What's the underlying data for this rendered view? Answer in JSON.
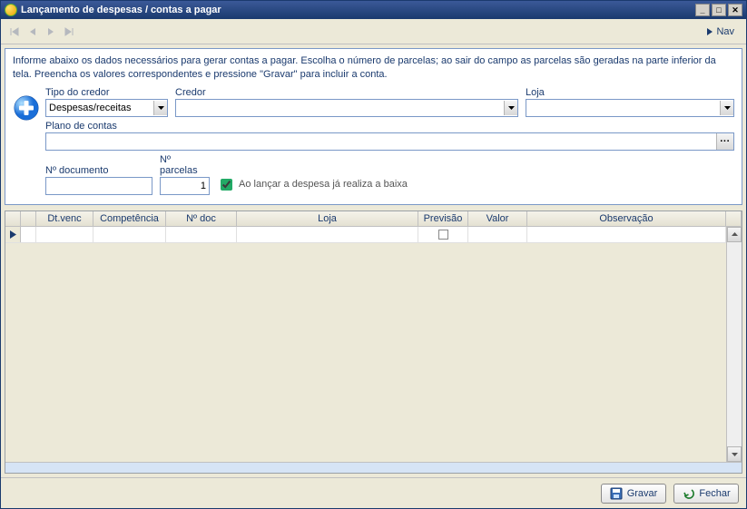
{
  "window": {
    "title": "Lançamento de despesas / contas a pagar"
  },
  "toolbar": {
    "nav_label": "Nav"
  },
  "info_text": "Informe abaixo os dados necessários para gerar contas a pagar. Escolha o número de parcelas; ao sair do campo as parcelas são geradas na parte inferior da tela. Preencha os valores correspondentes e pressione \"Gravar\" para  incluir a conta.",
  "form": {
    "tipo_credor_label": "Tipo do credor",
    "tipo_credor_value": "Despesas/receitas",
    "credor_label": "Credor",
    "credor_value": "",
    "loja_label": "Loja",
    "loja_value": "",
    "plano_label": "Plano de contas",
    "plano_value": "",
    "num_doc_label": "Nº documento",
    "num_doc_value": "",
    "num_parc_label": "Nº parcelas",
    "num_parc_value": "1",
    "check_label": "Ao lançar a despesa já realiza a baixa"
  },
  "grid": {
    "headers": {
      "dtvenc": "Dt.venc",
      "comp": "Competência",
      "doc": "Nº doc",
      "loja": "Loja",
      "prev": "Previsão",
      "valor": "Valor",
      "obs": "Observação"
    }
  },
  "buttons": {
    "gravar": "Gravar",
    "fechar": "Fechar"
  }
}
